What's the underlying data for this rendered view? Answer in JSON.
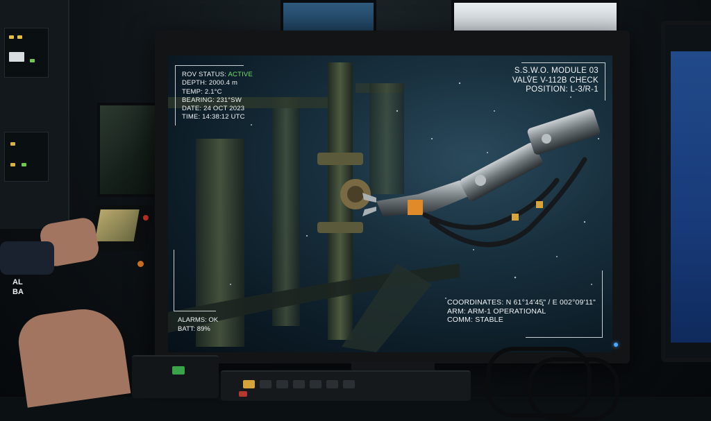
{
  "hud": {
    "top_left": {
      "rov_status_label": "ROV STATUS:",
      "rov_status_value": "ACTIVE",
      "depth": "DEPTH: 2000.4 m",
      "temp": "TEMP: 2.1°C",
      "bearing": "BEARING: 231°SW",
      "date": "DATE: 24 OCT 2023",
      "time": "TIME: 14:38:12 UTC"
    },
    "top_right": {
      "module": "S.S.W.O. MODULE 03",
      "valve": "VALVE V-112B CHECK",
      "position": "POSITION: L-3/R-1"
    },
    "bottom_left": {
      "alarms": "ALARMS: OK",
      "battery": "BATT: 89%"
    },
    "bottom_right": {
      "coordinates": "COORDINATES: N 61°14'45\" / E 002°09'11\"",
      "arm": "ARM: ARM-1 OPERATIONAL",
      "comm": "COMM: STABLE"
    }
  },
  "side_screen": {
    "line1": "AL",
    "line2": "BA"
  },
  "colors": {
    "status_active": "#6fe36c",
    "hud_text": "#f2f4f5",
    "power_led": "#4aa8ff"
  }
}
